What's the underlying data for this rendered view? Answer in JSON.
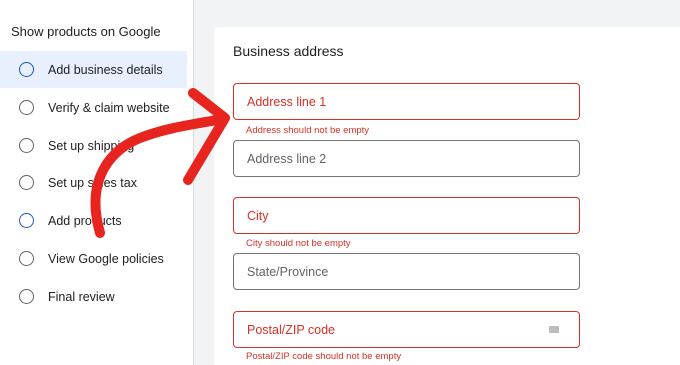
{
  "sidebar": {
    "title": "Show products on Google",
    "steps": [
      {
        "label": "Add business details",
        "state": "active"
      },
      {
        "label": "Verify & claim website",
        "state": "todo"
      },
      {
        "label": "Set up shipping",
        "state": "todo"
      },
      {
        "label": "Set up sales tax",
        "state": "todo"
      },
      {
        "label": "Add products",
        "state": "highlight"
      },
      {
        "label": "View Google policies",
        "state": "todo"
      },
      {
        "label": "Final review",
        "state": "todo"
      }
    ]
  },
  "form": {
    "title": "Business address",
    "fields": [
      {
        "placeholder": "Address line 1",
        "error": "Address should not be empty"
      },
      {
        "placeholder": "Address line 2",
        "error": ""
      },
      {
        "placeholder": "City",
        "error": "City should not be empty"
      },
      {
        "placeholder": "State/Province",
        "error": ""
      },
      {
        "placeholder": "Postal/ZIP code",
        "error": "Postal/ZIP code should not be empty"
      }
    ]
  },
  "colors": {
    "accent": "#1a56c9",
    "error": "#d93025",
    "annotation_arrow": "#e8241e",
    "active_bg": "#e8f0fe"
  }
}
